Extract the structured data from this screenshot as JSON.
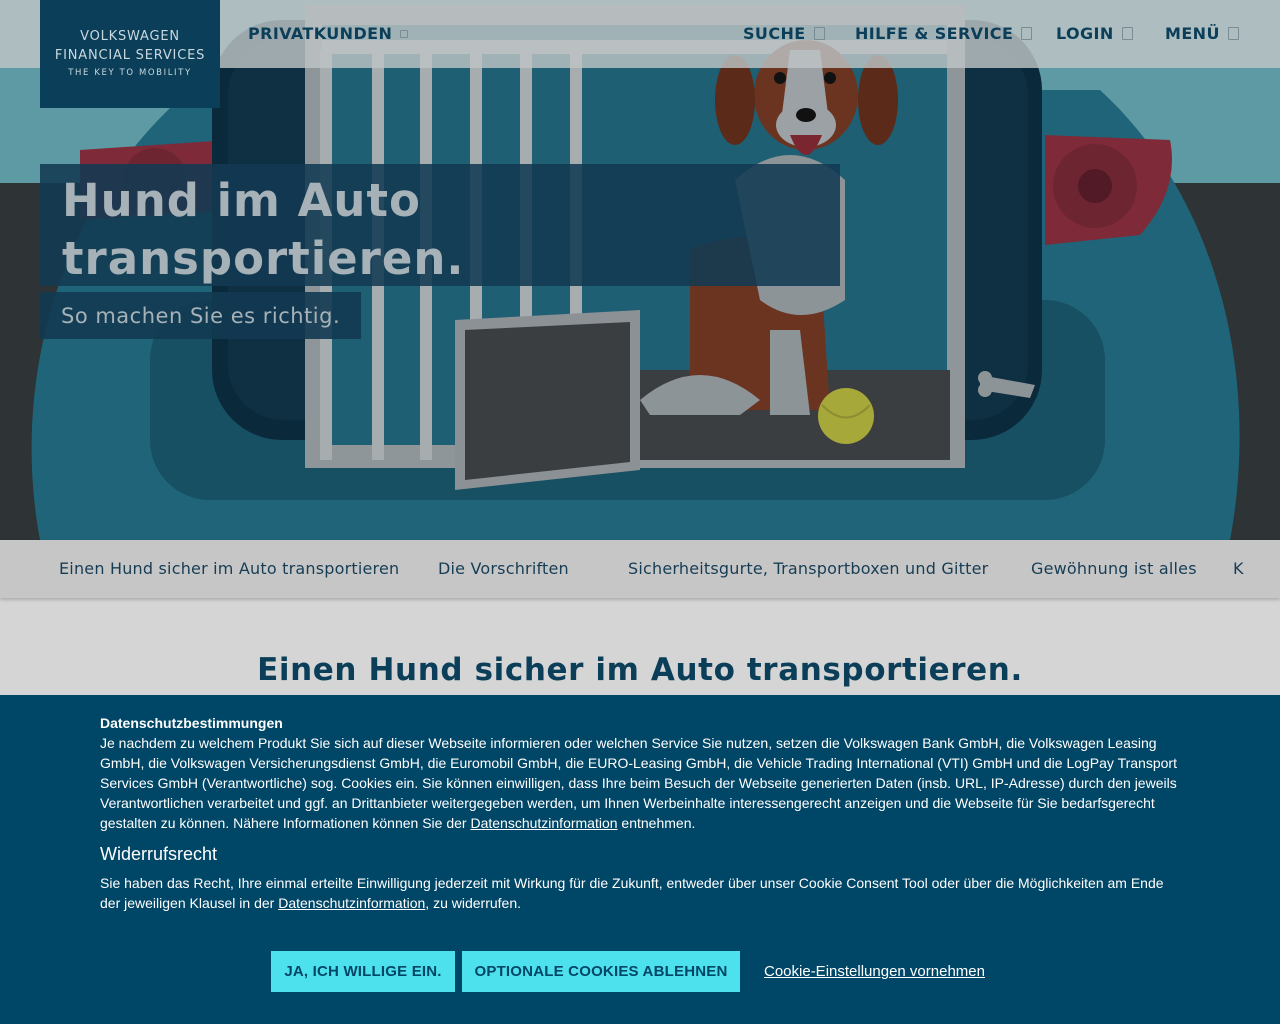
{
  "logo": {
    "line1": "VOLKSWAGEN",
    "line2": "FINANCIAL SERVICES",
    "tagline": "THE KEY TO MOBILITY"
  },
  "header": {
    "segment": "PRIVATKUNDEN",
    "search": "SUCHE",
    "help": "HILFE & SERVICE",
    "login": "LOGIN",
    "menu": "MENÜ"
  },
  "hero": {
    "title": "Hund im Auto transportieren.",
    "subtitle": "So machen Sie es richtig."
  },
  "anchor_nav": {
    "items": [
      "Einen Hund sicher im Auto transportieren",
      "Die Vorschriften",
      "Sicherheitsgurte, Transportboxen und Gitter",
      "Gewöhnung ist alles",
      "K"
    ]
  },
  "main": {
    "heading": "Einen Hund sicher im Auto transportieren."
  },
  "cookie": {
    "title": "Datenschutzbestimmungen",
    "body_text": "Je nachdem zu welchem Produkt Sie sich auf dieser Webseite informieren oder welchen Service Sie nutzen, setzen die Volkswagen Bank GmbH, die Volkswagen Leasing GmbH, die Volkswagen Versicherungsdienst GmbH, die Euromobil GmbH, die EURO-Leasing GmbH, die Vehicle Trading International (VTI) GmbH und die LogPay Transport Services GmbH (Verantwortliche) sog. Cookies ein. Sie können einwilligen, dass Ihre beim Besuch der Webseite generierten Daten (insb. URL, IP-Adresse) durch den jeweils Verantwortlichen verarbeitet und ggf. an Drittanbieter weitergegeben werden, um Ihnen Werbeinhalte interessengerecht anzeigen und die Webseite für Sie bedarfsgerecht gestalten zu können. Nähere Informationen können Sie der",
    "body_link": "Datenschutzinformation",
    "body_end": " entnehmen.",
    "revocation_title": "Widerrufsrecht",
    "revocation_text": "Sie haben das Recht, Ihre einmal erteilte Einwilligung jederzeit mit Wirkung für die Zukunft, entweder über unser Cookie Consent Tool oder über die Möglichkeiten am Ende der jeweiligen Klausel in der",
    "revocation_link": "Datenschutzinformation",
    "revocation_end": ", zu widerrufen.",
    "accept_label": "JA, ICH WILLIGE EIN.",
    "reject_label": "OPTIONALE COOKIES ABLEHNEN",
    "settings_label": "Cookie-Einstellungen vornehmen"
  },
  "colors": {
    "brand_dark": "#0b3e58",
    "banner_bg": "#004666",
    "button_accent": "#4de1ed"
  }
}
